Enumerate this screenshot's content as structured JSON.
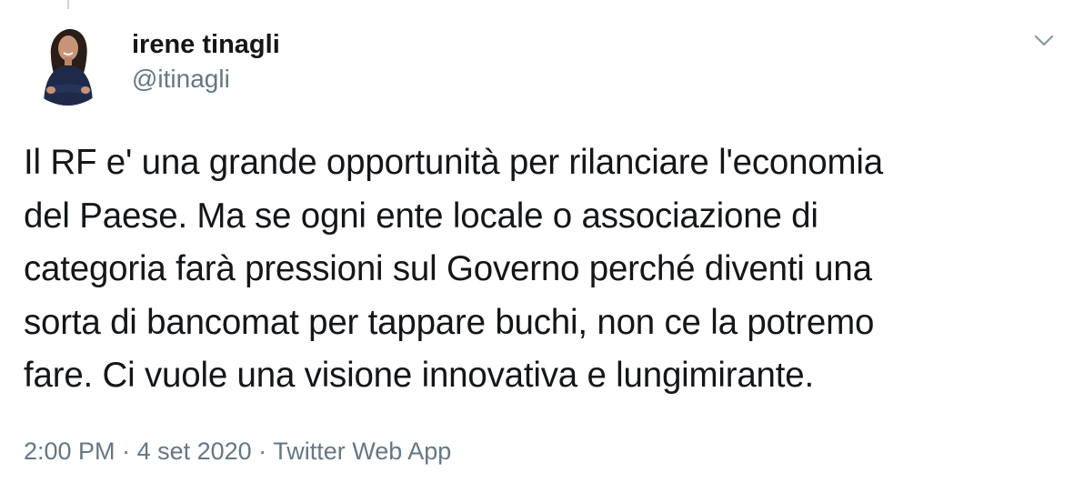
{
  "author": {
    "display_name": "irene tinagli",
    "handle": "@itinagli",
    "avatar_icon": "profile-photo"
  },
  "tweet": {
    "text": "Il RF e' una grande opportunità per rilanciare l'economia\ndel Paese. Ma se ogni ente locale o associazione di\ncategoria farà pressioni sul Governo perché diventi una\nsorta di bancomat per tappare buchi, non ce la potremo\nfare. Ci vuole una visione innovativa e lungimirante."
  },
  "meta": {
    "time": "2:00 PM",
    "separator": " · ",
    "date": "4 set 2020",
    "source": "Twitter Web App"
  },
  "menu_icon": "chevron-down-icon",
  "colors": {
    "text": "#14171a",
    "secondary": "#657786",
    "background": "#ffffff"
  }
}
